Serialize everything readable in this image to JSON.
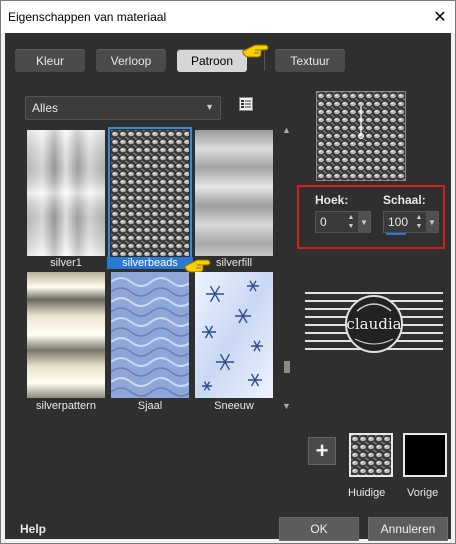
{
  "window": {
    "title": "Eigenschappen van materiaal",
    "close_glyph": "✕"
  },
  "tabs": [
    {
      "label": "Kleur",
      "active": false
    },
    {
      "label": "Verloop",
      "active": false
    },
    {
      "label": "Patroon",
      "active": true
    },
    {
      "label": "Textuur",
      "active": false
    }
  ],
  "category_select": {
    "value": "Alles"
  },
  "patterns": [
    {
      "label": "silver1",
      "selected": false
    },
    {
      "label": "silverbeads",
      "selected": true
    },
    {
      "label": "silverfill",
      "selected": false
    },
    {
      "label": "silverpattern",
      "selected": false
    },
    {
      "label": "Sjaal",
      "selected": false
    },
    {
      "label": "Sneeuw",
      "selected": false
    }
  ],
  "params": {
    "angle_label": "Hoek:",
    "angle_value": "0",
    "scale_label": "Schaal:",
    "scale_value": "100"
  },
  "logo": {
    "text": "claudia"
  },
  "swatches": {
    "current_label": "Huidige",
    "previous_label": "Vorige"
  },
  "footer": {
    "help": "Help",
    "ok": "OK",
    "cancel": "Annuleren"
  },
  "colors": {
    "panel_bg": "#2f2f2f",
    "selection_blue": "#2a78d6",
    "highlight_red": "#d41f1f"
  }
}
